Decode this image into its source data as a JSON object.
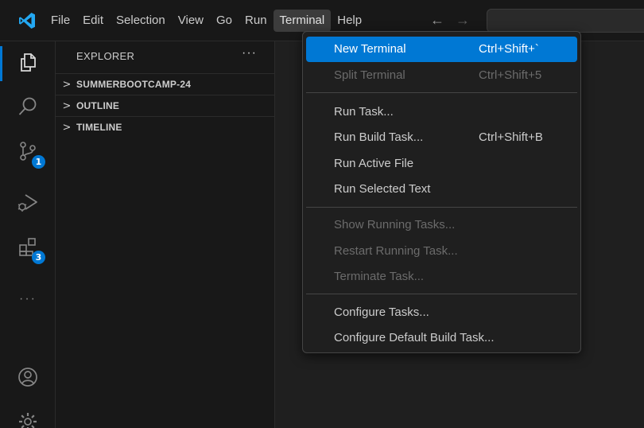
{
  "app": {
    "logo_icon": "vscode-logo-icon",
    "accent": "#0078d4"
  },
  "menubar": {
    "items": [
      "File",
      "Edit",
      "Selection",
      "View",
      "Go",
      "Run",
      "Terminal",
      "Help"
    ],
    "active": "Terminal",
    "back_icon": "←",
    "forward_icon": "→"
  },
  "activitybar": {
    "items": [
      {
        "icon": "explorer-files-icon",
        "active": true
      },
      {
        "icon": "search-icon"
      },
      {
        "icon": "source-control-icon",
        "badge": "1"
      },
      {
        "icon": "run-debug-icon"
      },
      {
        "icon": "extensions-icon",
        "badge": "3"
      },
      {
        "icon": "more-icon"
      },
      {
        "icon": "account-icon"
      },
      {
        "icon": "manage-gear-icon"
      }
    ],
    "more_label": "···"
  },
  "sidebar": {
    "title": "EXPLORER",
    "more_label": "···",
    "sections": [
      {
        "label": "SUMMERBOOTCAMP-24"
      },
      {
        "label": "OUTLINE"
      },
      {
        "label": "TIMELINE"
      }
    ],
    "chevron": ">"
  },
  "terminal_menu": {
    "groups": [
      [
        {
          "label": "New Terminal",
          "shortcut": "Ctrl+Shift+`",
          "highlighted": true
        },
        {
          "label": "Split Terminal",
          "shortcut": "Ctrl+Shift+5",
          "disabled": true
        }
      ],
      [
        {
          "label": "Run Task..."
        },
        {
          "label": "Run Build Task...",
          "shortcut": "Ctrl+Shift+B"
        },
        {
          "label": "Run Active File"
        },
        {
          "label": "Run Selected Text"
        }
      ],
      [
        {
          "label": "Show Running Tasks...",
          "disabled": true
        },
        {
          "label": "Restart Running Task...",
          "disabled": true
        },
        {
          "label": "Terminate Task...",
          "disabled": true
        }
      ],
      [
        {
          "label": "Configure Tasks..."
        },
        {
          "label": "Configure Default Build Task..."
        }
      ]
    ]
  }
}
